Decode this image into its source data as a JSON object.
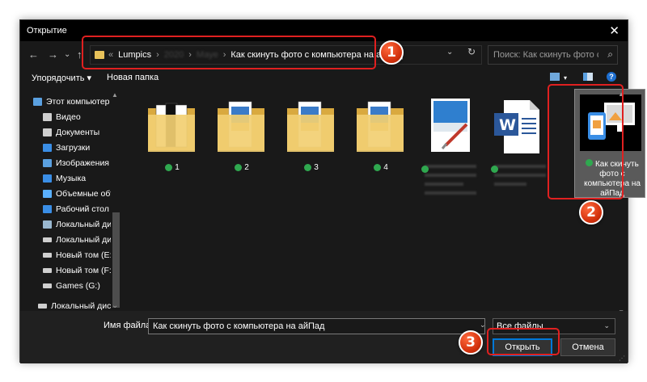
{
  "window": {
    "title": "Открытие",
    "close": "✕"
  },
  "nav": {
    "back": "←",
    "forward": "→",
    "dropdown": "⌄",
    "up": "↑"
  },
  "address": {
    "prefix": "«",
    "crumbs": [
      "Lumpics",
      "2020",
      "Мауе"
    ],
    "current": "Как скинуть фото с компьютера на айПад",
    "dropdown": "⌄",
    "refresh": "↻"
  },
  "search": {
    "placeholder": "Поиск: Как скинуть фото с к...",
    "icon": "⌕"
  },
  "toolbar": {
    "organize": "Упорядочить ▾",
    "new_folder": "Новая папка",
    "help": "?"
  },
  "sidebar": {
    "items": [
      {
        "label": "Этот компьютер",
        "icon": "computer-icon",
        "color": "#5aa0e0"
      },
      {
        "label": "Видео",
        "icon": "video-icon",
        "color": "#cfcfcf"
      },
      {
        "label": "Документы",
        "icon": "documents-icon",
        "color": "#cfcfcf"
      },
      {
        "label": "Загрузки",
        "icon": "downloads-icon",
        "color": "#3a8ee6"
      },
      {
        "label": "Изображения",
        "icon": "pictures-icon",
        "color": "#5aa0e0"
      },
      {
        "label": "Музыка",
        "icon": "music-icon",
        "color": "#3a8ee6"
      },
      {
        "label": "Объемные объ",
        "icon": "3d-objects-icon",
        "color": "#5ab0ff"
      },
      {
        "label": "Рабочий стол",
        "icon": "desktop-icon",
        "color": "#3a8ee6"
      },
      {
        "label": "Локальный дис",
        "icon": "drive-os-icon",
        "color": "#9ab8d0"
      },
      {
        "label": "Локальный дис",
        "icon": "drive-icon",
        "color": "#cfcfcf"
      },
      {
        "label": "Новый том (E:)",
        "icon": "drive-icon",
        "color": "#cfcfcf"
      },
      {
        "label": "Новый том (F:)",
        "icon": "drive-icon",
        "color": "#cfcfcf"
      },
      {
        "label": "Games (G:)",
        "icon": "drive-icon",
        "color": "#cfcfcf"
      },
      {
        "label": "Локальный диск",
        "icon": "drive-icon",
        "color": "#cfcfcf"
      }
    ]
  },
  "files": [
    {
      "label": "1",
      "type": "folder"
    },
    {
      "label": "2",
      "type": "folder"
    },
    {
      "label": "3",
      "type": "folder"
    },
    {
      "label": "4",
      "type": "folder"
    },
    {
      "label": "",
      "type": "image"
    },
    {
      "label": "",
      "type": "word"
    }
  ],
  "selected_file": {
    "label": "Как скинуть фото с компьютера на айПад"
  },
  "bottom": {
    "filename_label": "Имя файла:",
    "filename_value": "Как скинуть фото с компьютера на айПад",
    "filetype": "Все файлы",
    "open": "Открыть",
    "cancel": "Отмена"
  },
  "markers": [
    "1",
    "2",
    "3"
  ],
  "colors": {
    "accent": "#0078d7",
    "highlight": "#e02020",
    "marker": "#e0451a",
    "folder": "#e8c25a"
  }
}
